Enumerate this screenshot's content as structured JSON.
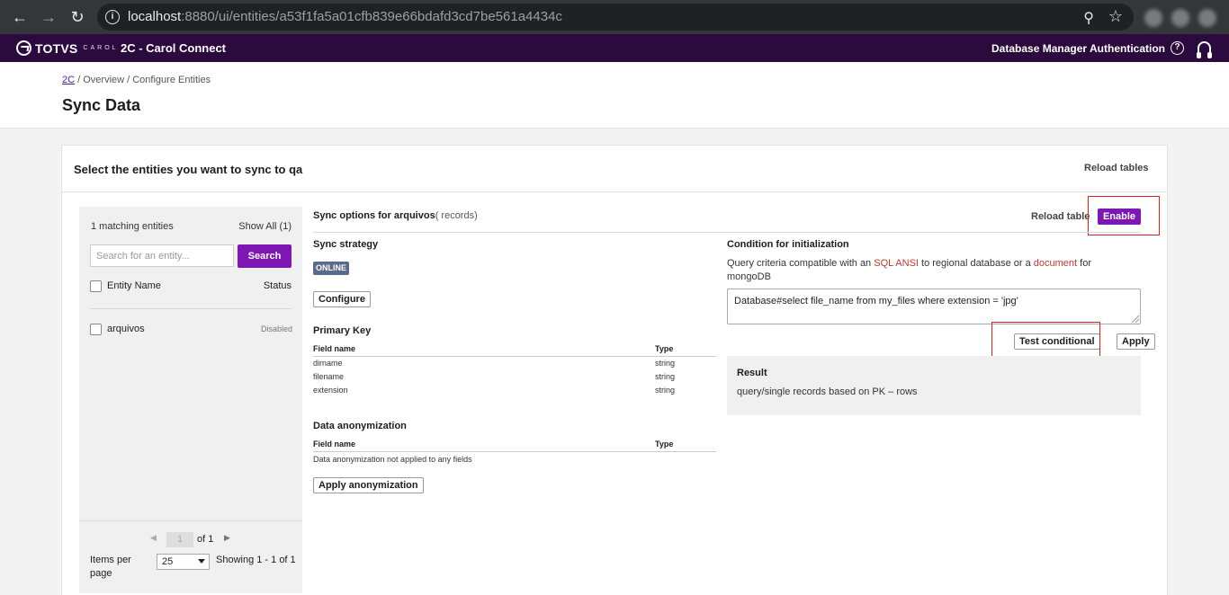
{
  "browser": {
    "url_host": "localhost",
    "url_path": ":8880/ui/entities/a53f1fa5a01cfb839e66bdafd3cd7be561a4434c"
  },
  "appbar": {
    "logo_text": "TOTVS",
    "logo_sub": "CAROL",
    "app_title": "2C - Carol Connect",
    "database_manager": "Database Manager",
    "authentication": "Authentication",
    "help_glyph": "?"
  },
  "breadcrumb": {
    "root": "2C",
    "rest": " / Overview / Configure Entities"
  },
  "page_title": "Sync Data",
  "card": {
    "title": "Select the entities you want to sync to qa",
    "reload_tables": "Reload tables"
  },
  "left_panel": {
    "match_count": "1 matching entities",
    "show_all": "Show All (1)",
    "search_placeholder": "Search for an entity...",
    "search_button": "Search",
    "col_entity": "Entity Name",
    "col_status": "Status",
    "rows": [
      {
        "name": "arquivos",
        "status": "Disabled"
      }
    ],
    "pagination": {
      "page": "1",
      "of_label": "of 1",
      "items_per_page": "Items per page",
      "page_size": "25",
      "showing": "Showing 1 - 1 of 1"
    }
  },
  "sync": {
    "title": "Sync options for arquivos",
    "records": "( records)",
    "reload_table": "Reload table",
    "enable": "Enable",
    "strategy_title": "Sync strategy",
    "strategy_badge": "ONLINE",
    "configure": "Configure",
    "pk_title": "Primary Key",
    "pk_col_field": "Field name",
    "pk_col_type": "Type",
    "pk_rows": [
      {
        "field": "dirname",
        "type": "string"
      },
      {
        "field": "filename",
        "type": "string"
      },
      {
        "field": "extension",
        "type": "string"
      }
    ],
    "anon_title": "Data anonymization",
    "anon_col_field": "Field name",
    "anon_col_type": "Type",
    "anon_empty": "Data anonymization not applied to any fields",
    "apply_anon": "Apply anonymization"
  },
  "condition": {
    "title": "Condition for initialization",
    "desc_1": "Query criteria compatible with an ",
    "desc_sql": "SQL ANSI",
    "desc_2": " to regional database or a ",
    "desc_doc": "document",
    "desc_3": " for mongoDB",
    "query": "Database#select file_name from my_files where extension = 'jpg'",
    "test_button": "Test conditional",
    "apply_button": "Apply",
    "result_title": "Result",
    "result_text": "query/single records based on PK – rows"
  },
  "colors": {
    "appbar_bg": "#2b0a3d",
    "accent": "#7e16b3",
    "highlight": "#e02020"
  }
}
